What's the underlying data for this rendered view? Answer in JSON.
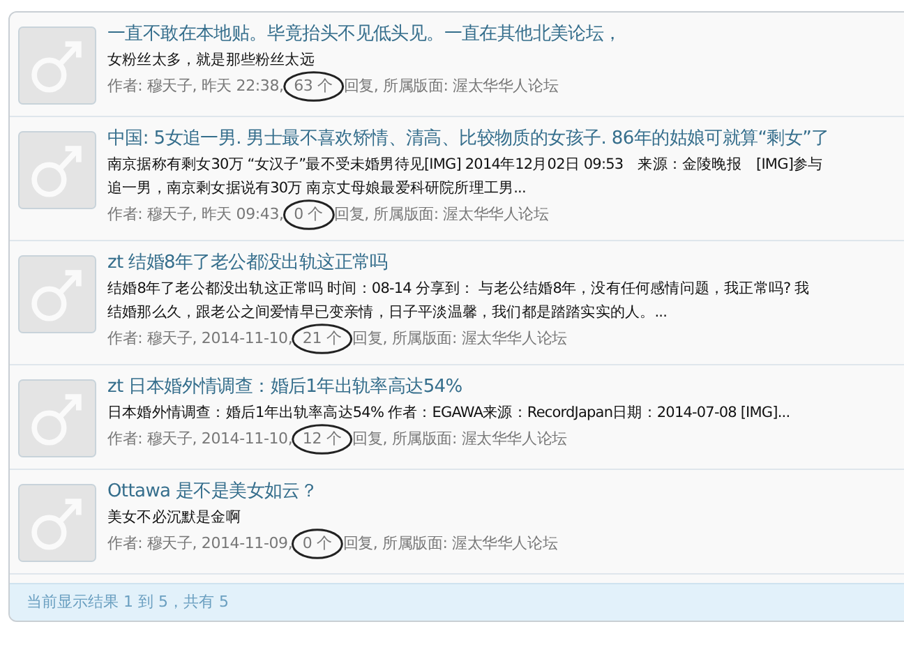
{
  "results": [
    {
      "title": "一直不敢在本地贴。毕竟抬头不见低头见。一直在其他北美论坛，",
      "excerpt": [
        "女粉丝太多，就是那些粉丝太远"
      ],
      "meta_before": "作者: 穆天子, 昨天 22:38, ",
      "replies": "63 个",
      "meta_after": "回复, 所属版面: 渥太华华人论坛",
      "circled": true
    },
    {
      "title": "中国: 5女追一男. 男士最不喜欢矫情、清高、比较物质的女孩子. 86年的姑娘可就算“剩女”了",
      "excerpt": [
        "南京据称有剩女30万 “女汉子”最不受未婚男待见[IMG] 2014年12月02日 09:53　来源：金陵晚报　[IMG]参与",
        "追一男，南京剩女据说有30万 南京丈母娘最爱科研院所理工男..."
      ],
      "meta_before": "作者: 穆天子, 昨天 09:43, ",
      "replies": "0 个",
      "meta_after": "回复, 所属版面: 渥太华华人论坛",
      "circled": true
    },
    {
      "title": "zt 结婚8年了老公都没出轨这正常吗",
      "excerpt": [
        "结婚8年了老公都没出轨这正常吗 时间：08-14 分享到：  与老公结婚8年，没有任何感情问题，我正常吗? 我",
        "结婚那么久，跟老公之间爱情早已变亲情，日子平淡温馨，我们都是踏踏实实的人。..."
      ],
      "meta_before": "作者: 穆天子, 2014-11-10, ",
      "replies": "21 个",
      "meta_after": "回复, 所属版面: 渥太华华人论坛",
      "circled": true
    },
    {
      "title": "zt 日本婚外情调查：婚后1年出轨率高达54%",
      "excerpt": [
        "日本婚外情调查：婚后1年出轨率高达54% 作者：EGAWA来源：RecordJapan日期：2014-07-08 [IMG]..."
      ],
      "meta_before": "作者: 穆天子, 2014-11-10, ",
      "replies": "12 个",
      "meta_after": "回复, 所属版面: 渥太华华人论坛",
      "circled": true
    },
    {
      "title": "Ottawa 是不是美女如云？",
      "excerpt": [
        "美女不必沉默是金啊"
      ],
      "meta_before": "作者: 穆天子, 2014-11-09, ",
      "replies": "0 个",
      "meta_after": "回复, 所属版面: 渥太华华人论坛",
      "circled": true
    }
  ],
  "footer": "当前显示结果 1 到 5，共有 5"
}
